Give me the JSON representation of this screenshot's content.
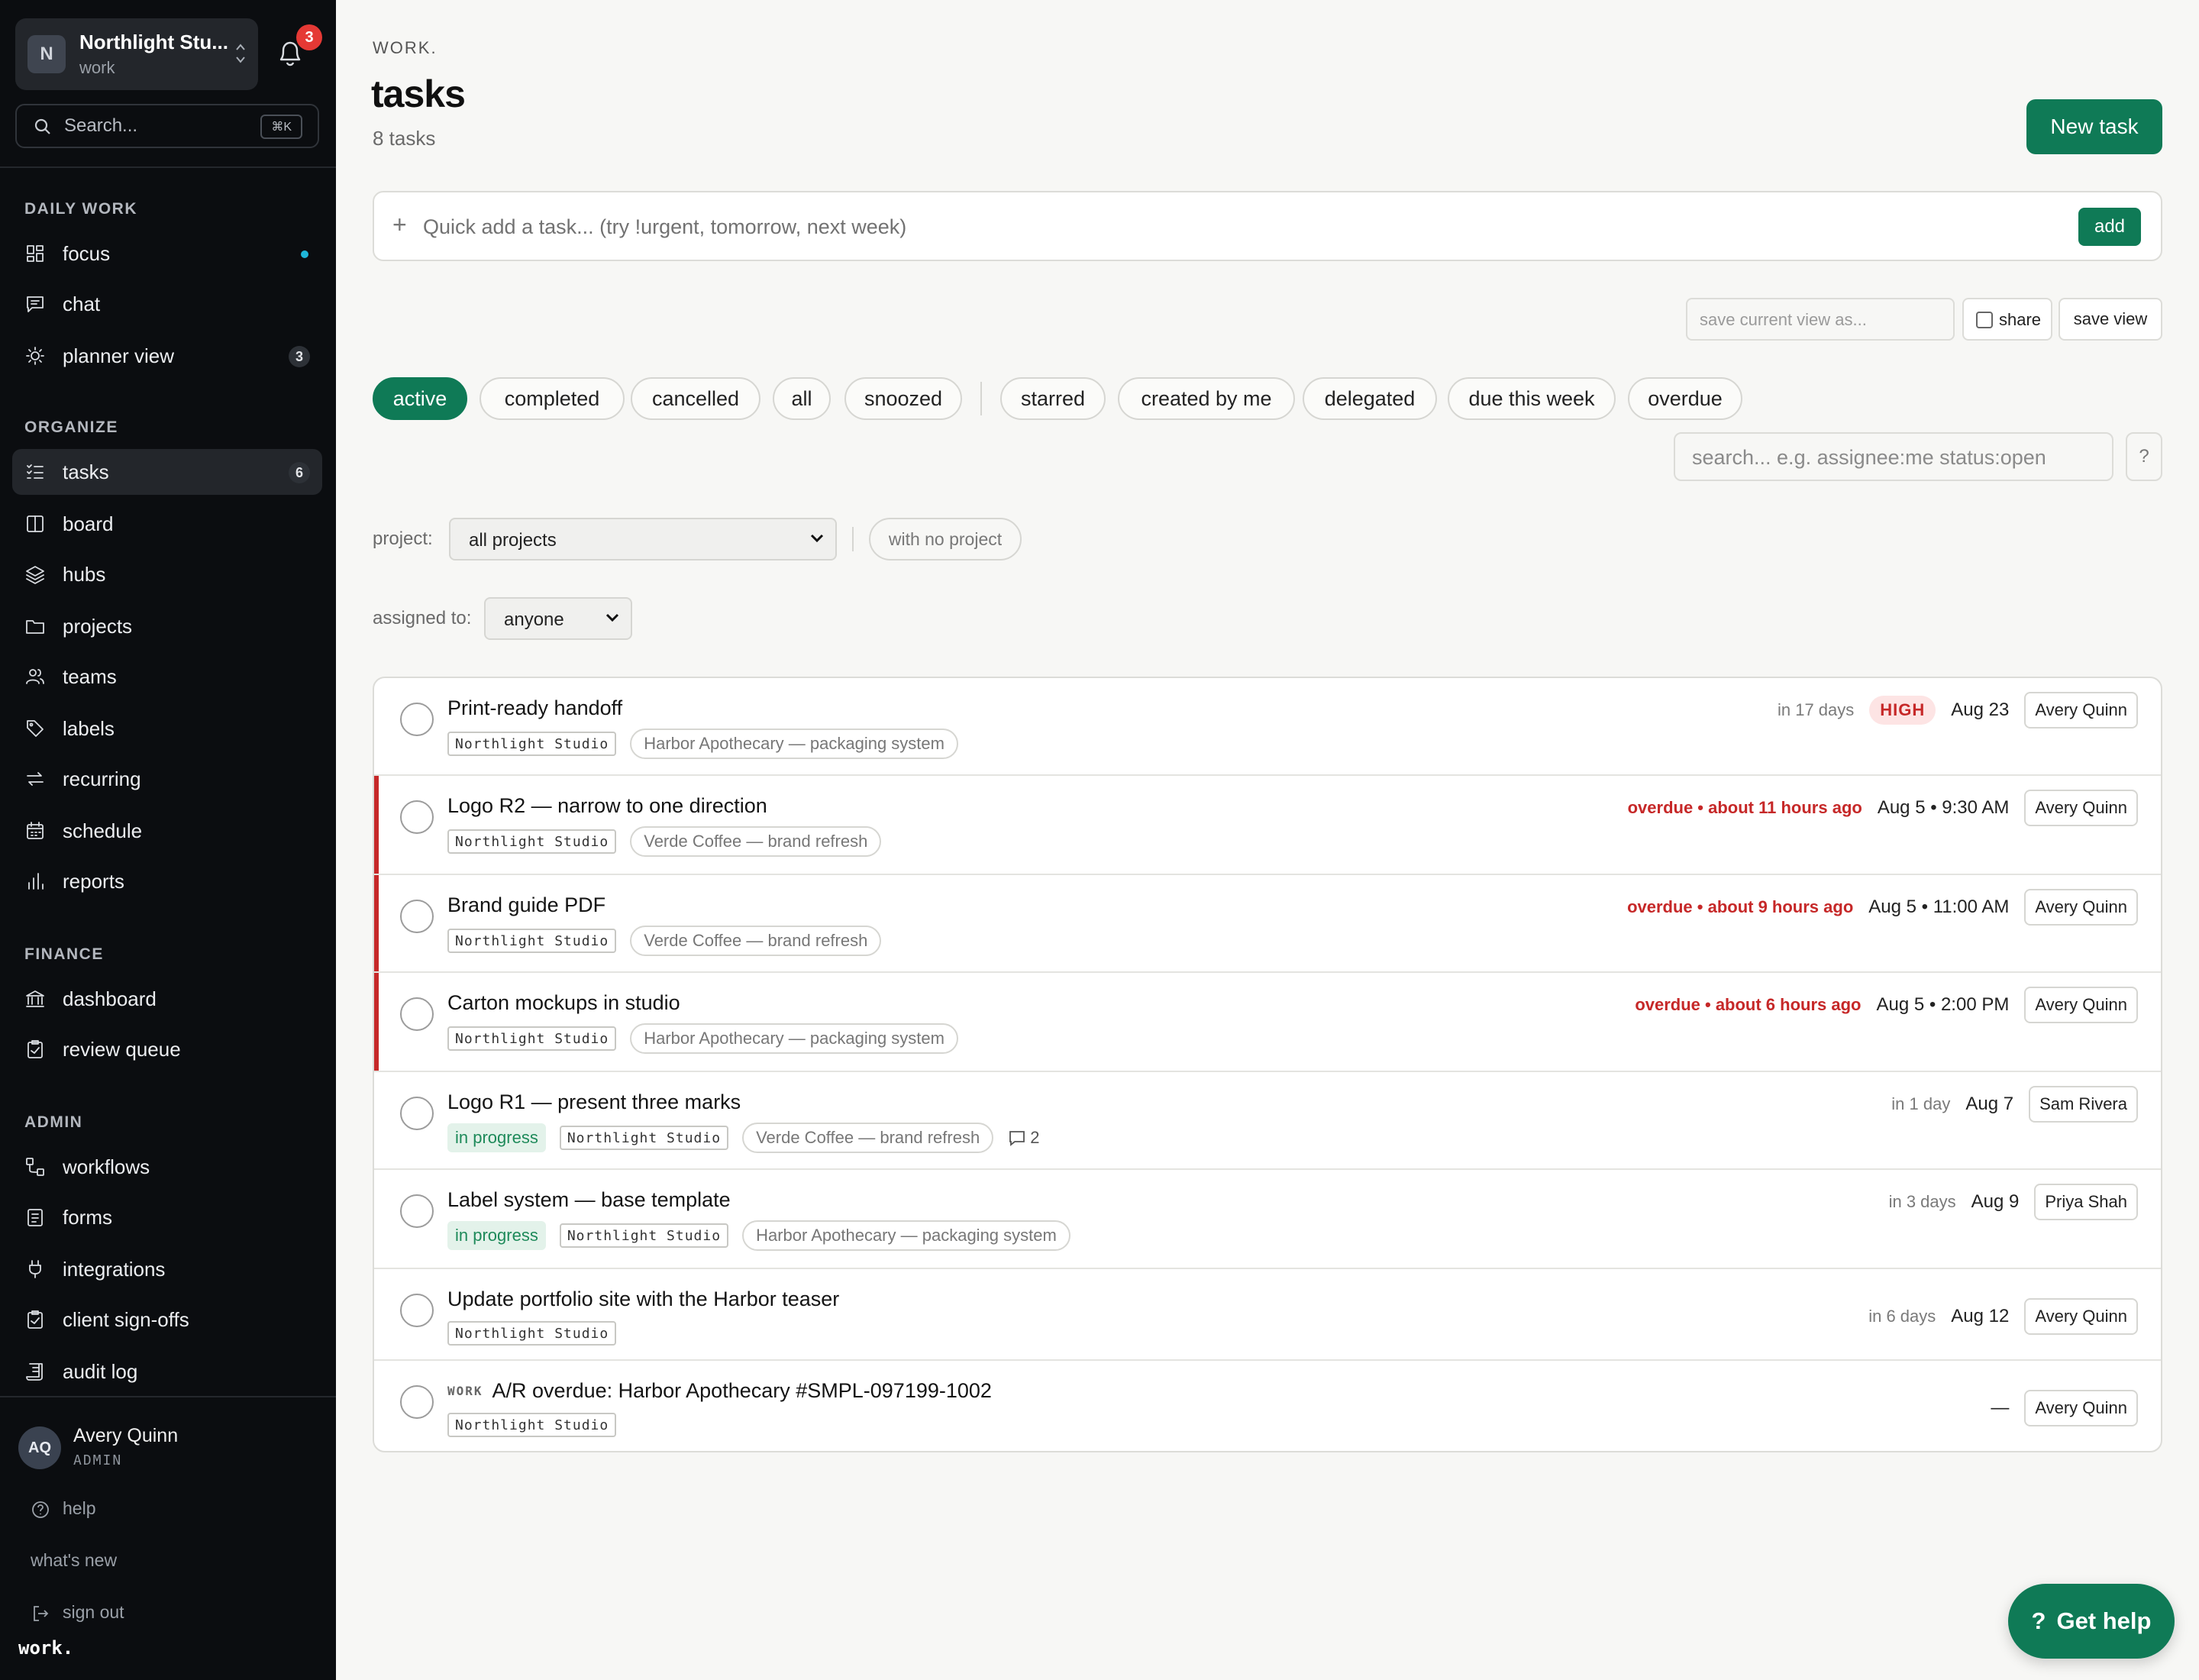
{
  "workspace": {
    "initial": "N",
    "name": "Northlight Stu...",
    "sub": "work"
  },
  "notifications": {
    "count": "3"
  },
  "sidebar_search": {
    "placeholder": "Search...",
    "shortcut": "⌘K"
  },
  "sections": {
    "daily": "DAILY WORK",
    "organize": "ORGANIZE",
    "finance": "FINANCE",
    "admin": "ADMIN"
  },
  "nav": {
    "focus": "focus",
    "chat": "chat",
    "planner": "planner view",
    "planner_badge": "3",
    "tasks": "tasks",
    "tasks_badge": "6",
    "board": "board",
    "hubs": "hubs",
    "projects": "projects",
    "teams": "teams",
    "labels": "labels",
    "recurring": "recurring",
    "schedule": "schedule",
    "reports": "reports",
    "dashboard": "dashboard",
    "review_queue": "review queue",
    "workflows": "workflows",
    "forms": "forms",
    "integrations": "integrations",
    "client_signoffs": "client sign-offs",
    "audit_log": "audit log"
  },
  "user": {
    "initials": "AQ",
    "name": "Avery Quinn",
    "role": "ADMIN"
  },
  "footer_links": {
    "help": "help",
    "whats_new": "what's new",
    "sign_out": "sign out"
  },
  "wordmark": "work.",
  "page": {
    "kicker": "WORK.",
    "title": "tasks",
    "count": "8 tasks",
    "new_task": "New task"
  },
  "quick_add": {
    "placeholder": "Quick add a task... (try !urgent, tomorrow, next week)",
    "add": "add"
  },
  "save_view": {
    "placeholder": "save current view as...",
    "share": "share",
    "button": "save view"
  },
  "chips": [
    "active",
    "completed",
    "cancelled",
    "all",
    "snoozed",
    "starred",
    "created by me",
    "delegated",
    "due this week",
    "overdue"
  ],
  "query": {
    "placeholder": "search... e.g. assignee:me status:open",
    "help": "?"
  },
  "filters": {
    "project_label": "project:",
    "project_value": "all projects",
    "no_project": "with no project",
    "assigned_label": "assigned to:",
    "assigned_value": "anyone"
  },
  "tasks": [
    {
      "title": "Print-ready handoff",
      "status": "",
      "studio": "Northlight Studio",
      "project": "Harbor Apothecary — packaging system",
      "comments": "",
      "relative": "in 17 days",
      "overdue": false,
      "priority": "HIGH",
      "due": "Aug 23",
      "assignee": "Avery Quinn",
      "prefix": ""
    },
    {
      "title": "Logo R2 — narrow to one direction",
      "status": "",
      "studio": "Northlight Studio",
      "project": "Verde Coffee — brand refresh",
      "comments": "",
      "relative": "overdue • about 11 hours ago",
      "overdue": true,
      "priority": "",
      "due": "Aug 5 • 9:30 AM",
      "assignee": "Avery Quinn",
      "prefix": ""
    },
    {
      "title": "Brand guide PDF",
      "status": "",
      "studio": "Northlight Studio",
      "project": "Verde Coffee — brand refresh",
      "comments": "",
      "relative": "overdue • about 9 hours ago",
      "overdue": true,
      "priority": "",
      "due": "Aug 5 • 11:00 AM",
      "assignee": "Avery Quinn",
      "prefix": ""
    },
    {
      "title": "Carton mockups in studio",
      "status": "",
      "studio": "Northlight Studio",
      "project": "Harbor Apothecary — packaging system",
      "comments": "",
      "relative": "overdue • about 6 hours ago",
      "overdue": true,
      "priority": "",
      "due": "Aug 5 • 2:00 PM",
      "assignee": "Avery Quinn",
      "prefix": ""
    },
    {
      "title": "Logo R1 — present three marks",
      "status": "in progress",
      "studio": "Northlight Studio",
      "project": "Verde Coffee — brand refresh",
      "comments": "2",
      "relative": "in 1 day",
      "overdue": false,
      "priority": "",
      "due": "Aug 7",
      "assignee": "Sam Rivera",
      "prefix": ""
    },
    {
      "title": "Label system — base template",
      "status": "in progress",
      "studio": "Northlight Studio",
      "project": "Harbor Apothecary — packaging system",
      "comments": "",
      "relative": "in 3 days",
      "overdue": false,
      "priority": "",
      "due": "Aug 9",
      "assignee": "Priya Shah",
      "prefix": ""
    },
    {
      "title": "Update portfolio site with the Harbor teaser",
      "status": "",
      "studio": "Northlight Studio",
      "project": "",
      "comments": "",
      "relative": "in 6 days",
      "overdue": false,
      "priority": "",
      "due": "Aug 12",
      "assignee": "Avery Quinn",
      "prefix": ""
    },
    {
      "title": "A/R overdue: Harbor Apothecary #SMPL-097199-1002",
      "status": "",
      "studio": "Northlight Studio",
      "project": "",
      "comments": "",
      "relative": "",
      "overdue": false,
      "priority": "",
      "due": "—",
      "assignee": "Avery Quinn",
      "prefix": "WORK"
    }
  ],
  "get_help": "Get help",
  "colors": {
    "accent": "#0f7a56",
    "overdue": "#c62828",
    "sidebar": "#0b0d10",
    "badge": "#e53935"
  }
}
